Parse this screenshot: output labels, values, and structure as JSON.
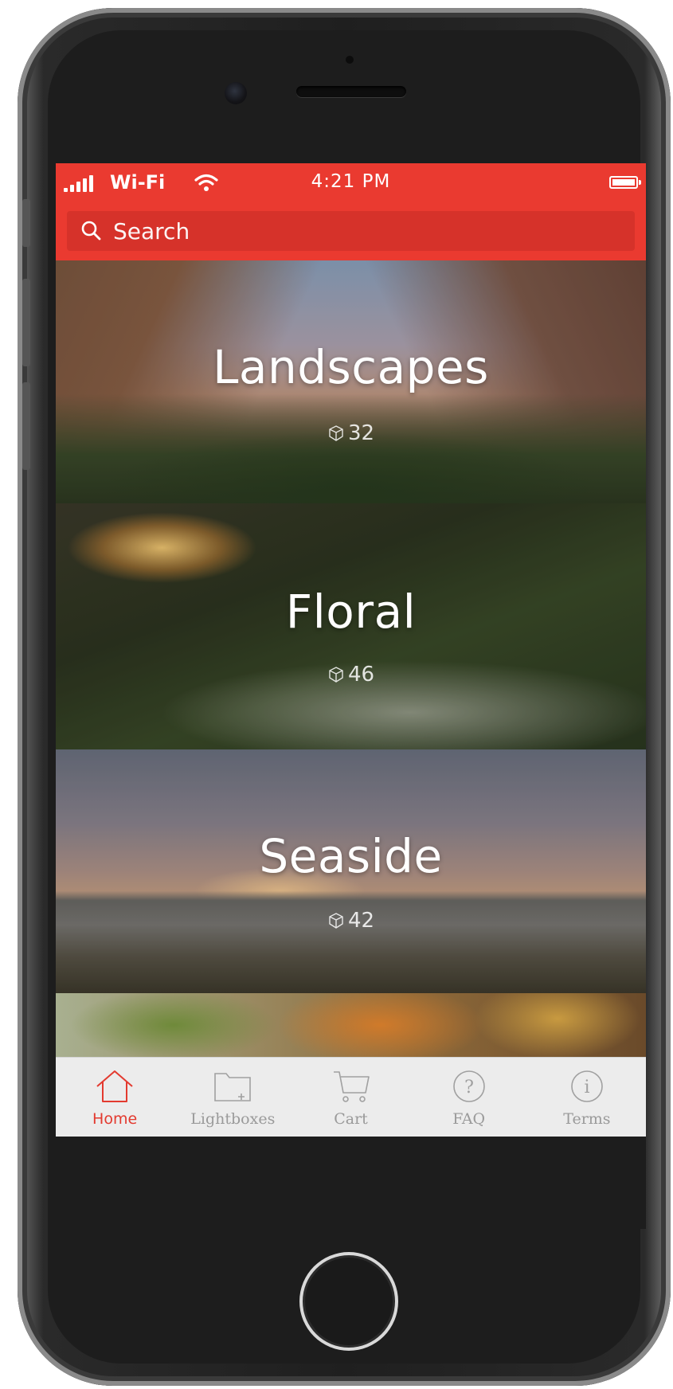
{
  "status_bar": {
    "carrier": "Wi-Fi",
    "time": "4:21 PM"
  },
  "search": {
    "placeholder": "Search"
  },
  "categories": [
    {
      "title": "Landscapes",
      "count": "32"
    },
    {
      "title": "Floral",
      "count": "46"
    },
    {
      "title": "Seaside",
      "count": "42"
    }
  ],
  "tabs": [
    {
      "label": "Home",
      "icon": "home-icon",
      "active": true
    },
    {
      "label": "Lightboxes",
      "icon": "folder-add-icon",
      "active": false
    },
    {
      "label": "Cart",
      "icon": "cart-icon",
      "active": false
    },
    {
      "label": "FAQ",
      "icon": "question-icon",
      "active": false
    },
    {
      "label": "Terms",
      "icon": "info-icon",
      "active": false
    }
  ],
  "colors": {
    "accent": "#ea3a30",
    "tab_active": "#e33a2f",
    "tab_inactive": "#9a9a9a"
  }
}
